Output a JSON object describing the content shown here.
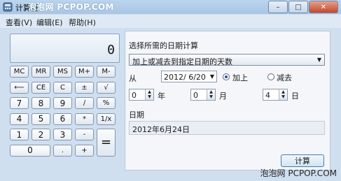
{
  "window": {
    "title": "计算器",
    "watermark_top": "泡泡网 PCPOP.COM",
    "controls": [
      "–",
      "□",
      "✕"
    ]
  },
  "menu": [
    "查看(V)",
    "编辑(E)",
    "帮助(H)"
  ],
  "calculator": {
    "display": "0",
    "keys": [
      {
        "label": "MC",
        "name": "mc-button"
      },
      {
        "label": "MR",
        "name": "mr-button"
      },
      {
        "label": "MS",
        "name": "ms-button"
      },
      {
        "label": "M+",
        "name": "m-plus-button"
      },
      {
        "label": "M-",
        "name": "m-minus-button"
      },
      {
        "label": "⟵",
        "name": "backspace-button"
      },
      {
        "label": "CE",
        "name": "ce-button"
      },
      {
        "label": "C",
        "name": "clear-button"
      },
      {
        "label": "±",
        "name": "negate-button"
      },
      {
        "label": "√",
        "name": "sqrt-button"
      },
      {
        "label": "7",
        "name": "digit-7-button"
      },
      {
        "label": "8",
        "name": "digit-8-button"
      },
      {
        "label": "9",
        "name": "digit-9-button"
      },
      {
        "label": "/",
        "name": "divide-button"
      },
      {
        "label": "%",
        "name": "percent-button"
      },
      {
        "label": "4",
        "name": "digit-4-button"
      },
      {
        "label": "5",
        "name": "digit-5-button"
      },
      {
        "label": "6",
        "name": "digit-6-button"
      },
      {
        "label": "*",
        "name": "multiply-button"
      },
      {
        "label": "1/x",
        "name": "reciprocal-button"
      },
      {
        "label": "1",
        "name": "digit-1-button"
      },
      {
        "label": "2",
        "name": "digit-2-button"
      },
      {
        "label": "3",
        "name": "digit-3-button"
      },
      {
        "label": "-",
        "name": "subtract-button"
      },
      {
        "label": "=",
        "name": "equals-button"
      },
      {
        "label": "0",
        "name": "digit-0-button"
      },
      {
        "label": ".",
        "name": "decimal-button"
      },
      {
        "label": "+",
        "name": "add-button"
      }
    ]
  },
  "date_calc": {
    "heading": "选择所需的日期计算",
    "mode_selected": "加上或减去到指定日期的天数",
    "from_label": "从",
    "from_date": "2012/  6/20",
    "add_label": "加上",
    "subtract_label": "减去",
    "operation": "add",
    "years": "0",
    "years_label": "年",
    "months": "0",
    "months_label": "月",
    "days": "4",
    "days_label": "日",
    "result_label": "日期",
    "result_value": "2012年6月24日",
    "calculate_label": "计算"
  },
  "watermark_bottom": "泡泡网  PCPOP.COM"
}
